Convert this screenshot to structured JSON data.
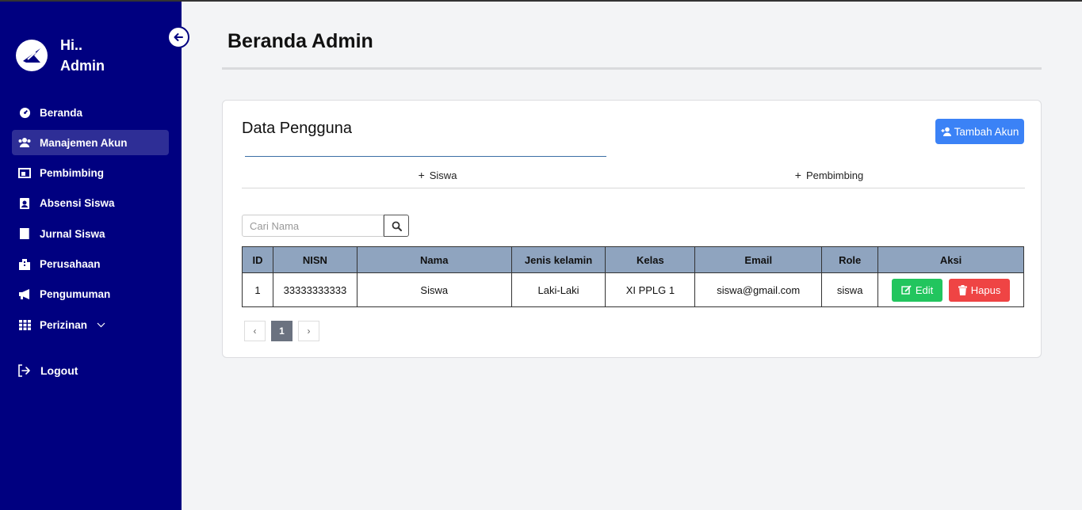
{
  "sidebar": {
    "greeting": "Hi..",
    "user": "Admin",
    "items": [
      {
        "label": "Beranda",
        "icon": "dashboard-icon"
      },
      {
        "label": "Manajemen Akun",
        "icon": "users-icon"
      },
      {
        "label": "Pembimbing",
        "icon": "chalkboard-teacher-icon"
      },
      {
        "label": "Absensi Siswa",
        "icon": "id-badge-icon"
      },
      {
        "label": "Jurnal Siswa",
        "icon": "book-icon"
      },
      {
        "label": "Perusahaan",
        "icon": "building-icon"
      },
      {
        "label": "Pengumuman",
        "icon": "megaphone-icon"
      },
      {
        "label": "Perizinan",
        "icon": "grid-icon"
      }
    ],
    "logout": "Logout"
  },
  "header": {
    "title": "Beranda Admin"
  },
  "card": {
    "title": "Data Pengguna",
    "add_button": "Tambah Akun",
    "tabs": [
      "Siswa",
      "Pembimbing"
    ],
    "active_tab": "Siswa",
    "search_placeholder": "Cari Nama"
  },
  "table": {
    "headers": [
      "ID",
      "NISN",
      "Nama",
      "Jenis kelamin",
      "Kelas",
      "Email",
      "Role",
      "Aksi"
    ],
    "rows": [
      {
        "id": "1",
        "nisn": "33333333333",
        "nama": "Siswa",
        "jenis_kelamin": "Laki-Laki",
        "kelas": "XI PPLG 1",
        "email": "siswa@gmail.com",
        "role": "siswa"
      }
    ],
    "edit_label": "Edit",
    "delete_label": "Hapus"
  },
  "pagination": {
    "prev": "‹",
    "current": "1",
    "next": "›"
  },
  "colors": {
    "sidebar_bg": "#000080",
    "primary": "#3b82f6",
    "success": "#22c55e",
    "danger": "#ef4444",
    "table_header": "#8fa4bf"
  }
}
